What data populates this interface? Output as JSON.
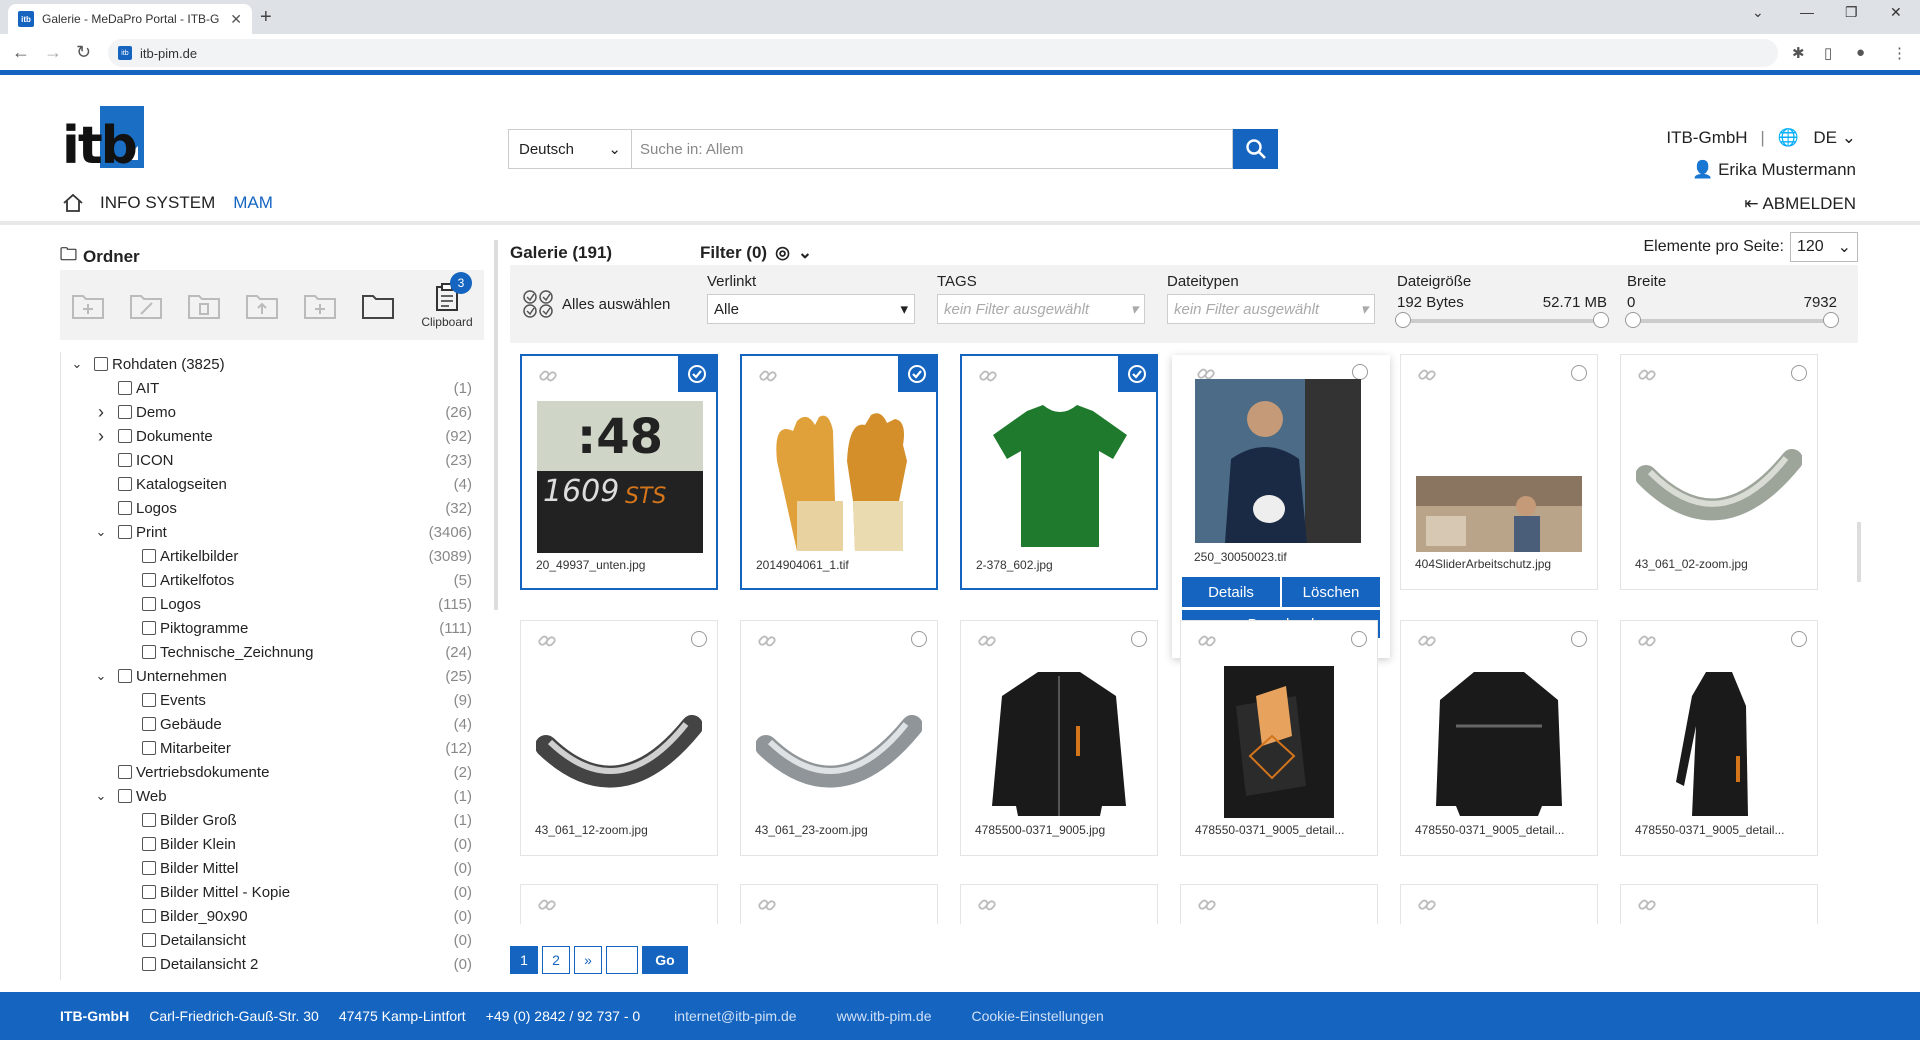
{
  "browser": {
    "tab_title": "Galerie - MeDaPro Portal - ITB-G",
    "url": "itb-pim.de"
  },
  "header": {
    "logo_text": "itb",
    "language_select": "Deutsch",
    "search_placeholder": "Suche in:  Allem",
    "company": "ITB-GmbH",
    "lang_code": "DE",
    "user_name": "Erika Mustermann",
    "logout": "ABMELDEN",
    "nav_info": "INFO SYSTEM",
    "nav_mam": "MAM"
  },
  "sidebar": {
    "title": "Ordner",
    "clipboard_label": "Clipboard",
    "clipboard_count": "3",
    "tree": [
      {
        "label": "Rohdaten (3825)",
        "count": "",
        "level": 0,
        "chev": "down"
      },
      {
        "label": "AIT",
        "count": "(1)",
        "level": 1,
        "chev": ""
      },
      {
        "label": "Demo",
        "count": "(26)",
        "level": 1,
        "chev": "right"
      },
      {
        "label": "Dokumente",
        "count": "(92)",
        "level": 1,
        "chev": "right"
      },
      {
        "label": "ICON",
        "count": "(23)",
        "level": 1,
        "chev": ""
      },
      {
        "label": "Katalogseiten",
        "count": "(4)",
        "level": 1,
        "chev": ""
      },
      {
        "label": "Logos",
        "count": "(32)",
        "level": 1,
        "chev": ""
      },
      {
        "label": "Print",
        "count": "(3406)",
        "level": 1,
        "chev": "down"
      },
      {
        "label": "Artikelbilder",
        "count": "(3089)",
        "level": 2,
        "chev": ""
      },
      {
        "label": "Artikelfotos",
        "count": "(5)",
        "level": 2,
        "chev": ""
      },
      {
        "label": "Logos",
        "count": "(115)",
        "level": 2,
        "chev": ""
      },
      {
        "label": "Piktogramme",
        "count": "(111)",
        "level": 2,
        "chev": ""
      },
      {
        "label": "Technische_Zeichnung",
        "count": "(24)",
        "level": 2,
        "chev": ""
      },
      {
        "label": "Unternehmen",
        "count": "(25)",
        "level": 1,
        "chev": "down"
      },
      {
        "label": "Events",
        "count": "(9)",
        "level": 2,
        "chev": ""
      },
      {
        "label": "Gebäude",
        "count": "(4)",
        "level": 2,
        "chev": ""
      },
      {
        "label": "Mitarbeiter",
        "count": "(12)",
        "level": 2,
        "chev": ""
      },
      {
        "label": "Vertriebsdokumente",
        "count": "(2)",
        "level": 1,
        "chev": ""
      },
      {
        "label": "Web",
        "count": "(1)",
        "level": 1,
        "chev": "down"
      },
      {
        "label": "Bilder Groß",
        "count": "(1)",
        "level": 2,
        "chev": ""
      },
      {
        "label": "Bilder Klein",
        "count": "(0)",
        "level": 2,
        "chev": ""
      },
      {
        "label": "Bilder Mittel",
        "count": "(0)",
        "level": 2,
        "chev": ""
      },
      {
        "label": "Bilder Mittel - Kopie",
        "count": "(0)",
        "level": 2,
        "chev": ""
      },
      {
        "label": "Bilder_90x90",
        "count": "(0)",
        "level": 2,
        "chev": ""
      },
      {
        "label": "Detailansicht",
        "count": "(0)",
        "level": 2,
        "chev": ""
      },
      {
        "label": "Detailansicht 2",
        "count": "(0)",
        "level": 2,
        "chev": ""
      }
    ]
  },
  "gallery": {
    "title": "Galerie (191)",
    "filter_title": "Filter (0)",
    "per_page_label": "Elemente pro Seite:",
    "per_page_value": "120",
    "select_all": "Alles auswählen",
    "filters": {
      "verlinkt_label": "Verlinkt",
      "verlinkt_value": "Alle",
      "tags_label": "TAGS",
      "tags_placeholder": "kein Filter ausgewählt",
      "types_label": "Dateitypen",
      "types_placeholder": "kein Filter ausgewählt",
      "size_label": "Dateigröße",
      "size_min": "192 Bytes",
      "size_max": "52.71 MB",
      "width_label": "Breite",
      "width_min": "0",
      "width_max": "7932"
    },
    "tiles": [
      {
        "name": "20_49937_unten.jpg",
        "kind": "display",
        "selected": true
      },
      {
        "name": "2014904061_1.tif",
        "kind": "gloves",
        "selected": true
      },
      {
        "name": "2-378_602.jpg",
        "kind": "shirt",
        "selected": true
      },
      {
        "name": "250_30050023.tif",
        "kind": "person",
        "selected": false,
        "hover": true
      },
      {
        "name": "404SliderArbeitschutz.jpg",
        "kind": "workshop",
        "selected": false
      },
      {
        "name": "43_061_02-zoom.jpg",
        "kind": "arc-light",
        "selected": false
      },
      {
        "name": "43_061_12-zoom.jpg",
        "kind": "arc-dark",
        "selected": false
      },
      {
        "name": "43_061_23-zoom.jpg",
        "kind": "arc-mid",
        "selected": false
      },
      {
        "name": "4785500-0371_9005.jpg",
        "kind": "jacket",
        "selected": false
      },
      {
        "name": "478550-0371_9005_detail...",
        "kind": "pocket",
        "selected": false
      },
      {
        "name": "478550-0371_9005_detail...",
        "kind": "jacket-back",
        "selected": false
      },
      {
        "name": "478550-0371_9005_detail...",
        "kind": "jacket-side",
        "selected": false
      }
    ],
    "hover_buttons": {
      "details": "Details",
      "delete": "Löschen",
      "download": "Download"
    },
    "pager": {
      "page1": "1",
      "page2": "2",
      "next": "»",
      "go": "Go"
    }
  },
  "footer": {
    "company": "ITB-GmbH",
    "street": "Carl-Friedrich-Gauß-Str. 30",
    "city": "47475 Kamp-Lintfort",
    "phone": "+49 (0) 2842 / 92 737 - 0",
    "email": "internet@itb-pim.de",
    "web": "www.itb-pim.de",
    "cookies": "Cookie-Einstellungen"
  },
  "colors": {
    "accent": "#1565c0",
    "panel": "#f2f2f2"
  }
}
